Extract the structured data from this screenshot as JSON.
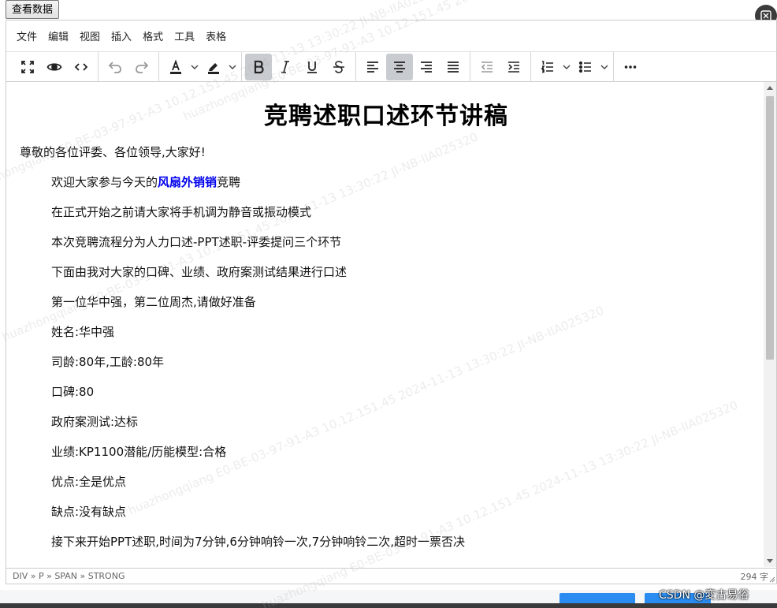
{
  "top_button": {
    "label": "查看数据"
  },
  "menubar": {
    "items": [
      "文件",
      "编辑",
      "视图",
      "插入",
      "格式",
      "工具",
      "表格"
    ]
  },
  "toolbar": {
    "groups": [
      [
        "fullscreen-icon",
        "preview-icon",
        "code-icon"
      ],
      [
        "undo-icon",
        "redo-icon"
      ],
      [
        "font-color-icon",
        "highlight-color-icon"
      ],
      [
        "bold-icon",
        "italic-icon",
        "underline-icon",
        "strikethrough-icon"
      ],
      [
        "align-left-icon",
        "align-center-icon",
        "align-right-icon",
        "align-justify-icon"
      ],
      [
        "outdent-icon",
        "indent-icon"
      ],
      [
        "numbered-list-icon",
        "bullet-list-icon"
      ],
      [
        "more-icon"
      ]
    ],
    "active": [
      "bold-icon",
      "align-center-icon"
    ]
  },
  "document": {
    "title": "竞聘述职口述环节讲稿",
    "greeting": "尊敬的各位评委、各位领导,大家好!",
    "welcome": {
      "prefix": "欢迎大家参与今天的",
      "highlight": "风扇外销销",
      "suffix": "竞聘"
    },
    "paragraphs": [
      "在正式开始之前请大家将手机调为静音或振动模式",
      "本次竞聘流程分为人力口述-PPT述职-评委提问三个环节",
      "下面由我对大家的口碑、业绩、政府案测试结果进行口述",
      "第一位华中强，第二位周杰,请做好准备",
      "姓名:华中强",
      "司龄:80年,工龄:80年",
      "口碑:80",
      "政府案测试:达标",
      "业绩:KP1100潜能/历能模型:合格",
      "优点:全是优点",
      "缺点:没有缺点",
      "接下来开始PPT述职,时间为7分钟,6分钟响铃一次,7分钟响铃二次,超时一票否决"
    ]
  },
  "statusbar": {
    "path": "DIV » P » SPAN » STRONG",
    "word_count": "294 字"
  },
  "footer": {
    "watermark_text": "CSDN @変古易俗"
  },
  "watermark": {
    "text": "huazhongqiang E0-BE-03-97-91-A3 10.12.151.45 2024-11-13 13:30:22 JI-NB-IIA025320"
  },
  "colors": {
    "accent_blue": "#0000ee",
    "active_button": "#c8cbcf",
    "footer_button": "#2a8cf0"
  }
}
